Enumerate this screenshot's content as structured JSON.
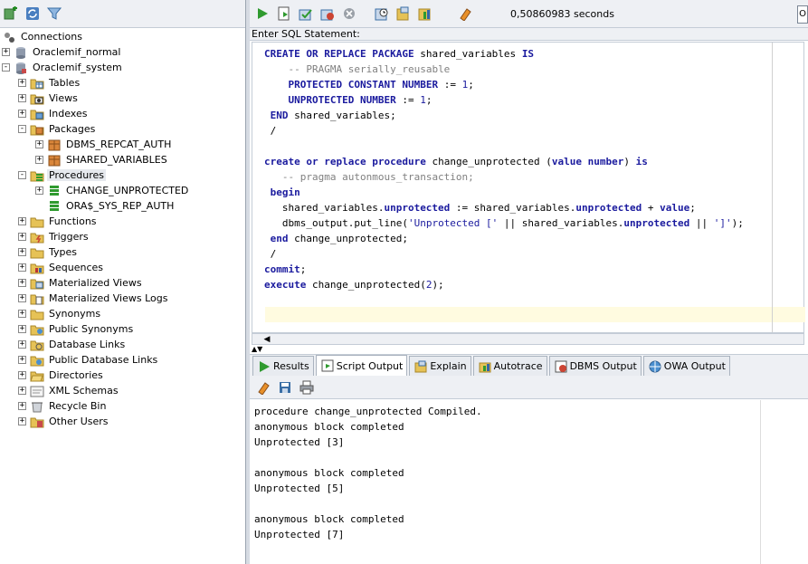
{
  "left_toolbar": {
    "icons": [
      "new-connection-icon",
      "refresh-icon",
      "filter-icon"
    ]
  },
  "tree": {
    "root_label": "Connections",
    "connections": [
      {
        "label": "Oraclemif_normal",
        "expanded": false
      },
      {
        "label": "Oraclemif_system",
        "expanded": true
      }
    ],
    "nodes": [
      {
        "label": "Tables",
        "icon": "tables-folder-icon",
        "toggle": "+"
      },
      {
        "label": "Views",
        "icon": "views-folder-icon",
        "toggle": "+"
      },
      {
        "label": "Indexes",
        "icon": "indexes-folder-icon",
        "toggle": "+"
      },
      {
        "label": "Packages",
        "icon": "packages-folder-icon",
        "toggle": "-"
      },
      {
        "label": "DBMS_REPCAT_AUTH",
        "icon": "package-icon",
        "toggle": "+"
      },
      {
        "label": "SHARED_VARIABLES",
        "icon": "package-icon",
        "toggle": "+"
      },
      {
        "label": "Procedures",
        "icon": "procedures-folder-icon",
        "toggle": "-"
      },
      {
        "label": "CHANGE_UNPROTECTED",
        "icon": "procedure-icon",
        "toggle": "+"
      },
      {
        "label": "ORA$_SYS_REP_AUTH",
        "icon": "procedure-icon",
        "toggle": ""
      },
      {
        "label": "Functions",
        "icon": "functions-folder-icon",
        "toggle": "+"
      },
      {
        "label": "Triggers",
        "icon": "triggers-folder-icon",
        "toggle": "+"
      },
      {
        "label": "Types",
        "icon": "types-folder-icon",
        "toggle": "+"
      },
      {
        "label": "Sequences",
        "icon": "sequences-folder-icon",
        "toggle": "+"
      },
      {
        "label": "Materialized Views",
        "icon": "mviews-folder-icon",
        "toggle": "+"
      },
      {
        "label": "Materialized Views Logs",
        "icon": "mview-logs-folder-icon",
        "toggle": "+"
      },
      {
        "label": "Synonyms",
        "icon": "synonyms-folder-icon",
        "toggle": "+"
      },
      {
        "label": "Public Synonyms",
        "icon": "public-synonyms-folder-icon",
        "toggle": "+"
      },
      {
        "label": "Database Links",
        "icon": "db-links-folder-icon",
        "toggle": "+"
      },
      {
        "label": "Public Database Links",
        "icon": "public-db-links-folder-icon",
        "toggle": "+"
      },
      {
        "label": "Directories",
        "icon": "directories-folder-icon",
        "toggle": "+"
      },
      {
        "label": "XML Schemas",
        "icon": "xml-schemas-folder-icon",
        "toggle": "+"
      },
      {
        "label": "Recycle Bin",
        "icon": "recycle-bin-icon",
        "toggle": "+"
      },
      {
        "label": "Other Users",
        "icon": "other-users-folder-icon",
        "toggle": "+"
      }
    ]
  },
  "main_toolbar": {
    "icons": [
      "run-statement-icon",
      "run-script-icon",
      "commit-icon",
      "rollback-icon",
      "cancel-icon",
      "sql-history-icon",
      "explain-plan-icon",
      "autotrace-icon",
      "clear-icon"
    ],
    "timing": "0,50860983 seconds",
    "edge_box": "O"
  },
  "editor": {
    "label": "Enter SQL Statement:",
    "lines": [
      "CREATE OR REPLACE PACKAGE shared_variables IS",
      "    -- PRAGMA serially_reusable",
      "    PROTECTED CONSTANT NUMBER := 1;",
      "    UNPROTECTED NUMBER := 1;",
      " END shared_variables;",
      " /",
      "",
      "create or replace procedure change_unprotected (value number) is",
      "   -- pragma autonmous_transaction;",
      " begin",
      "   shared_variables.unprotected := shared_variables.unprotected + value;",
      "   dbms_output.put_line('Unprotected [' || shared_variables.unprotected || ']');",
      " end change_unprotected;",
      " /",
      "commit;",
      "execute change_unprotected(2);"
    ]
  },
  "output_tabs": [
    {
      "label": "Results",
      "icon": "results-icon",
      "active": false
    },
    {
      "label": "Script Output",
      "icon": "script-output-icon",
      "active": true
    },
    {
      "label": "Explain",
      "icon": "explain-icon",
      "active": false
    },
    {
      "label": "Autotrace",
      "icon": "autotrace-icon",
      "active": false
    },
    {
      "label": "DBMS Output",
      "icon": "dbms-output-icon",
      "active": false
    },
    {
      "label": "OWA Output",
      "icon": "owa-output-icon",
      "active": false
    }
  ],
  "output_toolbar": {
    "icons": [
      "clear-output-icon",
      "save-output-icon",
      "print-output-icon"
    ]
  },
  "output": {
    "lines": [
      "procedure change_unprotected Compiled.",
      "anonymous block completed",
      "Unprotected [3]",
      "",
      "anonymous block completed",
      "Unprotected [5]",
      "",
      "anonymous block completed",
      "Unprotected [7]"
    ]
  }
}
